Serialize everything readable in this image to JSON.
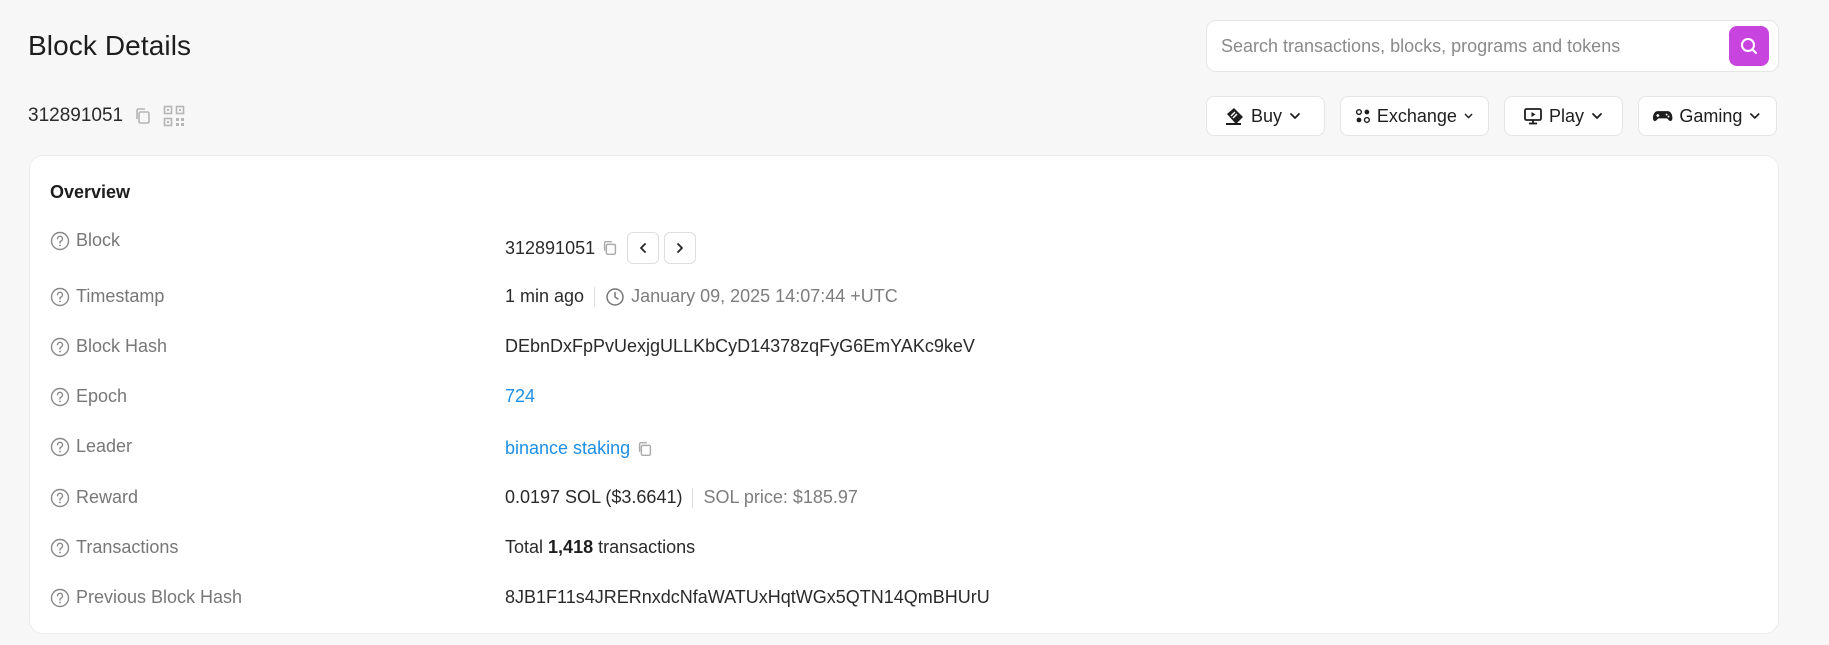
{
  "header": {
    "title": "Block Details",
    "block_number": "312891051"
  },
  "search": {
    "placeholder": "Search transactions, blocks, programs and tokens",
    "value": ""
  },
  "nav": {
    "buy": "Buy",
    "exchange": "Exchange",
    "play": "Play",
    "gaming": "Gaming"
  },
  "overview": {
    "title": "Overview",
    "block": {
      "label": "Block",
      "value": "312891051"
    },
    "timestamp": {
      "label": "Timestamp",
      "relative": "1 min ago",
      "absolute": "January 09, 2025 14:07:44 +UTC"
    },
    "block_hash": {
      "label": "Block Hash",
      "value": "DEbnDxFpPvUexjgULLKbCyD14378zqFyG6EmYAKc9keV"
    },
    "epoch": {
      "label": "Epoch",
      "value": "724"
    },
    "leader": {
      "label": "Leader",
      "value": "binance staking"
    },
    "reward": {
      "label": "Reward",
      "value": "0.0197 SOL ($3.6641)",
      "sol_price": "SOL price: $185.97"
    },
    "transactions": {
      "label": "Transactions",
      "prefix": "Total",
      "count": "1,418",
      "suffix": "transactions"
    },
    "previous_block_hash": {
      "label": "Previous Block Hash",
      "value": "8JB1F11s4JRERnxdcNfaWATUxHqtWGx5QTN14QmBHUrU"
    }
  },
  "colors": {
    "accent": "#c745de",
    "link": "#1e8fe5",
    "background": "#f7f7f7"
  }
}
